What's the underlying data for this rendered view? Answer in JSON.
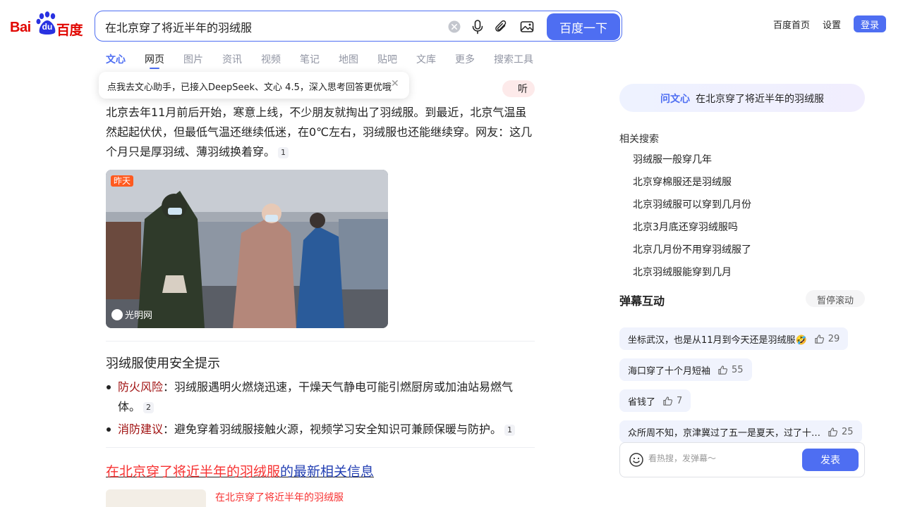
{
  "header": {
    "logo_text_left": "Bai",
    "logo_text_du": "du",
    "logo_text_right": "百度",
    "search_value": "在北京穿了将近半年的羽绒服",
    "search_button": "百度一下",
    "top_links": [
      "百度首页",
      "设置"
    ],
    "login_button": "登录"
  },
  "tabs": [
    {
      "label": "文心",
      "state": "brand"
    },
    {
      "label": "网页",
      "state": "active"
    },
    {
      "label": "图片"
    },
    {
      "label": "资讯"
    },
    {
      "label": "视频"
    },
    {
      "label": "笔记"
    },
    {
      "label": "地图"
    },
    {
      "label": "贴吧"
    },
    {
      "label": "文库"
    },
    {
      "label": "更多"
    },
    {
      "label": "搜索工具"
    }
  ],
  "tooltip": {
    "text": "点我去文心助手，已接入DeepSeek、文心 4.5，深入思考回答更优哦"
  },
  "listen_button": "听",
  "answer": {
    "paragraph": "北京去年11月前后开始，寒意上线，不少朋友就掏出了羽绒服。到最近，北京气温虽然起起伏伏，但最低气温还继续低迷，在0℃左右，羽绒服也还能继续穿。网友：这几个月只是厚羽绒、薄羽绒换着穿。",
    "paragraph_cite": "1",
    "photo_tag": "昨天",
    "photo_source": "光明网"
  },
  "safety": {
    "title": "羽绒服使用安全提示",
    "items": [
      {
        "keyword": "防火风险",
        "text": "：羽绒服遇明火燃烧迅速，干燥天气静电可能引燃厨房或加油站易燃气体。",
        "cite": "2"
      },
      {
        "keyword": "消防建议",
        "text": "：避免穿着羽绒服接触火源，视频学习安全知识可兼顾保暖与防护。",
        "cite": "1"
      }
    ]
  },
  "news": {
    "title_red": "在北京穿了将近半年的羽绒服",
    "title_blue": "的最新相关信息",
    "first_item": "在北京穿了将近半年的羽绒服"
  },
  "sidebar": {
    "ask_brand": "问文心",
    "ask_text": "在北京穿了将近半年的羽绒服",
    "related_title": "相关搜索",
    "related": [
      "羽绒服一般穿几年",
      "北京穿棉服还是羽绒服",
      "北京羽绒服可以穿到几月份",
      "北京3月底还穿羽绒服吗",
      "北京几月份不用穿羽绒服了",
      "北京羽绒服能穿到几月"
    ],
    "danmu_title": "弹幕互动",
    "pause_button": "暂停滚动",
    "danmu": [
      {
        "text": "坐标武汉，也是从11月到今天还是羽绒服🤣",
        "likes": "29"
      },
      {
        "text": "海口穿了十个月短袖",
        "likes": "55"
      },
      {
        "text": "省钱了",
        "likes": "7"
      },
      {
        "text": "众所周不知，京津冀过了五一是夏天，过了十…",
        "likes": "25"
      }
    ],
    "input_placeholder": "看热搜，发弹幕～",
    "send_button": "发表"
  },
  "colors": {
    "brand_blue": "#4e6ef2",
    "logo_red": "#e10601",
    "highlight_red": "#f73131",
    "link_blue": "#2440b3"
  }
}
